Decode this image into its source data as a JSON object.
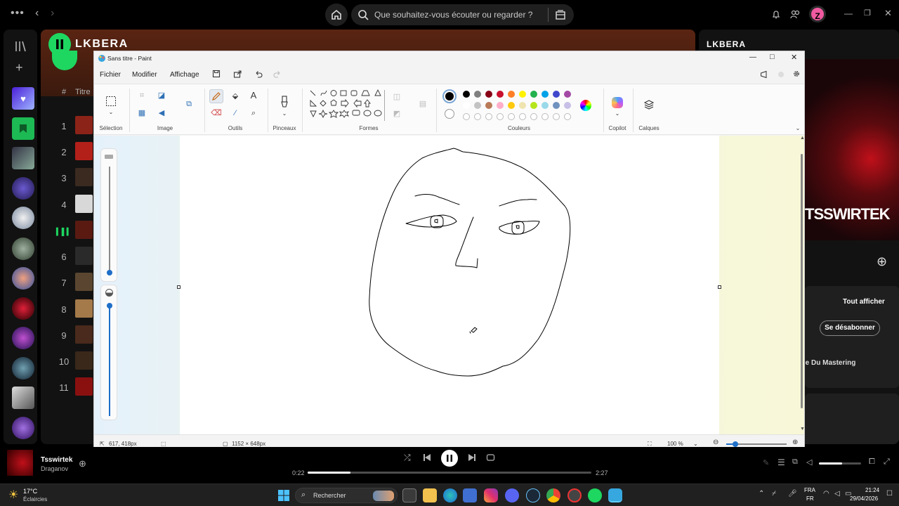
{
  "spotify": {
    "search_placeholder": "Que souhaitez-vous écouter ou regarder ?",
    "avatar_letter": "Z",
    "artist_name": "LKBERA",
    "right_title": "LKBERA",
    "col_title": "Titre",
    "col_hash": "#",
    "rows": [
      {
        "num": "1",
        "thumb": "#8c2318"
      },
      {
        "num": "2",
        "thumb": "#b3201a"
      },
      {
        "num": "3",
        "thumb": "#3a2a20"
      },
      {
        "num": "4",
        "thumb": "#d8d8d8"
      },
      {
        "num": "",
        "thumb": "#5a1a12"
      },
      {
        "num": "6",
        "thumb": "#2a2a2a"
      },
      {
        "num": "7",
        "thumb": "#5a4630"
      },
      {
        "num": "8",
        "thumb": "#a47a4a"
      },
      {
        "num": "9",
        "thumb": "#4a2a1c"
      },
      {
        "num": "10",
        "thumb": "#3a281a"
      },
      {
        "num": "11",
        "thumb": "#8a1010"
      }
    ],
    "right_panel": {
      "cover_text": "TSSWIRTEK",
      "show_all": "Tout afficher",
      "unsubscribe": "Se désabonner",
      "mastering_text": "rie Du Mastering"
    },
    "player": {
      "track": "Tsswirtek",
      "artist": "Draganov",
      "elapsed": "0:22",
      "duration": "2:27",
      "progress": 0.15,
      "volume": 0.55
    }
  },
  "paint": {
    "title": "Sans titre - Paint",
    "menu": [
      "Fichier",
      "Modifier",
      "Affichage"
    ],
    "groups": {
      "selection": "Sélection",
      "image": "Image",
      "outils": "Outils",
      "pinceaux": "Pinceaux",
      "formes": "Formes",
      "couleurs": "Couleurs",
      "copilot": "Copilot",
      "calques": "Calques"
    },
    "colors_row1": [
      "#000000",
      "#7f7f7f",
      "#880015",
      "#c8102e",
      "#ff7f27",
      "#fff200",
      "#22b14c",
      "#00a2e8",
      "#3f48cc",
      "#a349a4"
    ],
    "colors_row2": [
      "#ffffff",
      "#c3c3c3",
      "#b97a57",
      "#ffaec9",
      "#ffc90e",
      "#efe4b0",
      "#b5e61d",
      "#99d9ea",
      "#7092be",
      "#c8bfe7"
    ],
    "status": {
      "cursor": "617, 418px",
      "canvas_size": "1152 × 648px",
      "zoom": "100 %"
    }
  },
  "taskbar": {
    "weather_temp": "17°C",
    "weather_text": "Éclaircies",
    "search": "Rechercher",
    "lang1": "FRA",
    "lang2": "FR",
    "time": "21:24",
    "date": "29/04/2026"
  }
}
